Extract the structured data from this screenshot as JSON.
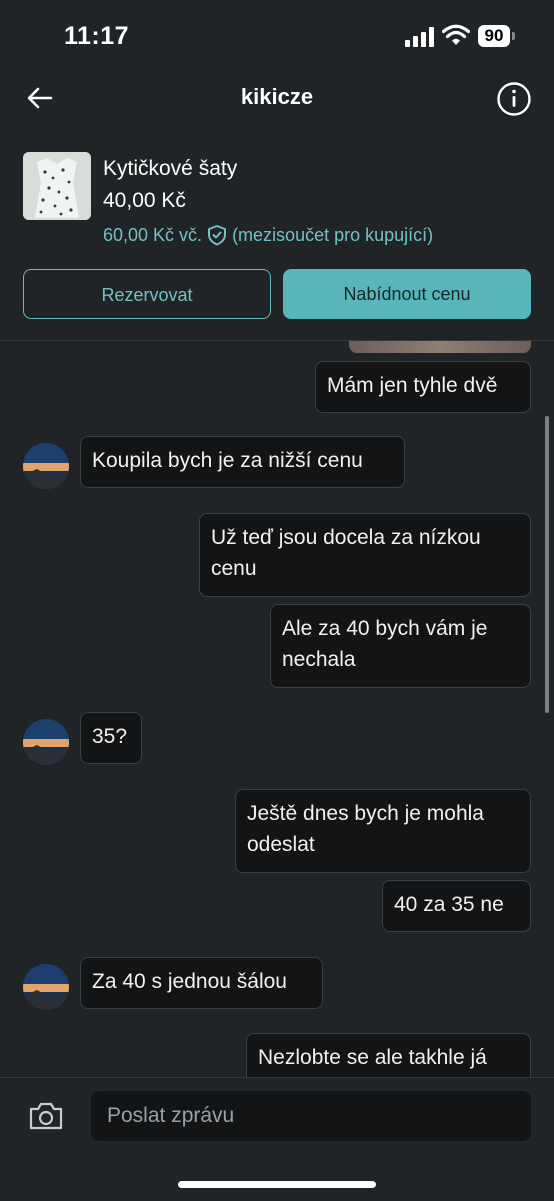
{
  "status": {
    "time": "11:17",
    "battery": "90"
  },
  "header": {
    "title": "kikicze"
  },
  "product": {
    "name": "Kytičkové šaty",
    "price": "40,00 Kč",
    "total_price": "60,00 Kč vč.",
    "total_note": "(mezisoučet pro kupující)"
  },
  "actions": {
    "reserve": "Rezervovat",
    "offer": "Nabídnout cenu"
  },
  "messages": [
    {
      "from": "me",
      "text": "Mám jen tyhle dvě"
    },
    {
      "from": "them",
      "text": "Koupila bych je za nižší cenu"
    },
    {
      "from": "me",
      "text": "Už teď jsou docela za nízkou cenu"
    },
    {
      "from": "me",
      "text": "Ale za 40 bych vám je nechala"
    },
    {
      "from": "them",
      "text": "35?"
    },
    {
      "from": "me",
      "text": "Ještě dnes bych je mohla odeslat"
    },
    {
      "from": "me",
      "text": "40 za 35 ne"
    },
    {
      "from": "them",
      "text": "Za 40 s jednou šálou"
    },
    {
      "from": "me",
      "text": "Nezlobte se ale takhle já"
    }
  ],
  "composer": {
    "placeholder": "Poslat zprávu"
  },
  "icons": {
    "back": "arrow-left-icon",
    "info": "info-icon",
    "shield": "shield-check-icon",
    "camera": "camera-icon"
  },
  "colors": {
    "accent": "#58b6ba",
    "background": "#202426",
    "bubble": "#121415"
  }
}
